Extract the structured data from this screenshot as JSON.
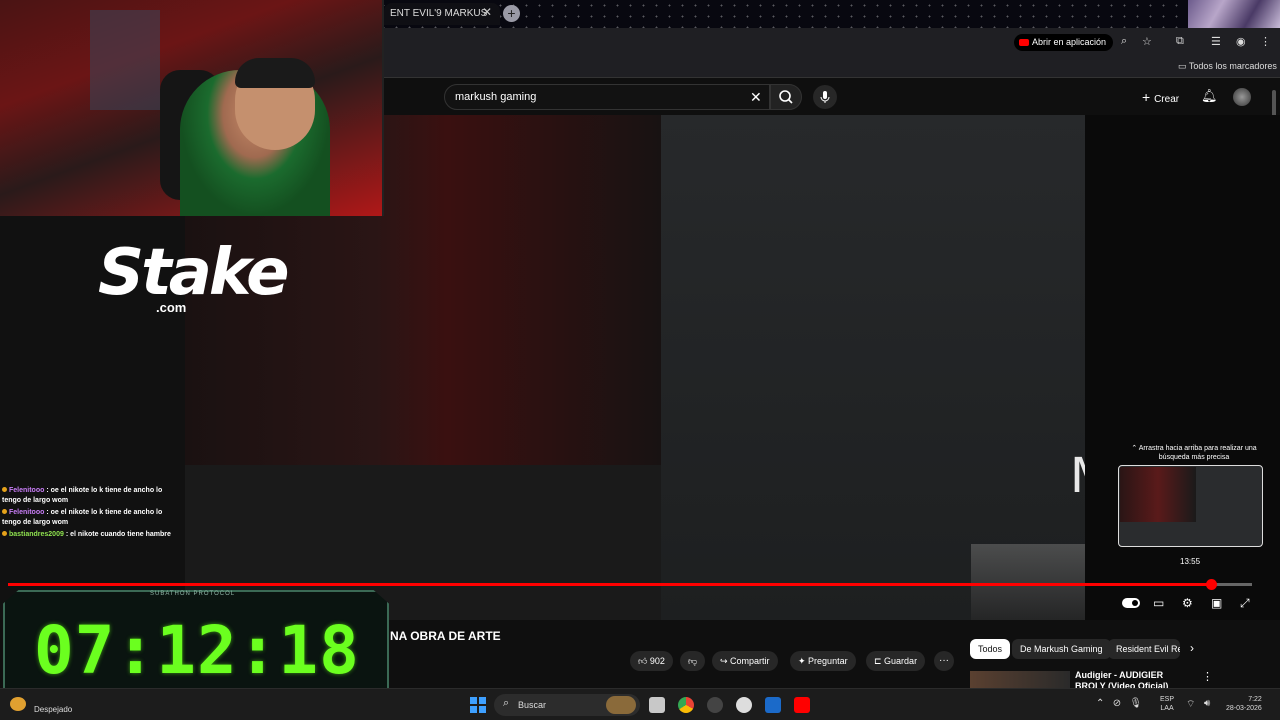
{
  "browser": {
    "tab_title": "ENT EVIL'9 MARKUS",
    "tab_close": "✕",
    "new_tab": "+",
    "open_in_app_label": "Abrir en aplicación",
    "bookmarks_all_label": "Todos los marcadores"
  },
  "youtube": {
    "search_value": "markush gaming",
    "search_clear": "✕",
    "create_label": "Crear",
    "hint_text": "Arrastra hacia arriba para realizar una búsqueda más precisa",
    "preview_time": "13:55",
    "progress": 0.97,
    "video_title": "NA OBRA DE ARTE",
    "like_count": "902",
    "share_label": "Compartir",
    "ask_label": "Preguntar",
    "save_label": "Guardar",
    "more_label": "···",
    "chips": [
      "Todos",
      "De Markush Gaming",
      "Resident Evil Re"
    ],
    "recommended_title": "Audigier - AUDIGIER BROLY (Video Oficial)"
  },
  "stream_overlay": {
    "stake_logo": "Stake",
    "stake_com": ".com",
    "chat": [
      {
        "user": "Felenitooo",
        "text": ": oe el nikote lo k tiene de ancho lo tengo de largo wom"
      },
      {
        "user": "Felenitooo",
        "text": ": oe el nikote lo k tiene de ancho lo tengo de largo wom"
      },
      {
        "user": "bastiandres2009",
        "text": ": el nikote cuando tiene hambre"
      }
    ],
    "timer_label": "SUBATHON PROTOCOL",
    "timer": "07:12:18"
  },
  "taskbar": {
    "weather": "Despejado",
    "search_label": "Buscar",
    "lang_top": "ESP",
    "lang_bottom": "LAA",
    "time": "7:22",
    "date": "28-03-2026"
  },
  "colors": {
    "accent": "#ff0000",
    "timer_green": "#6bff1f",
    "chat_user_purple": "#c97ef7",
    "chat_user_green": "#8fe24f"
  }
}
